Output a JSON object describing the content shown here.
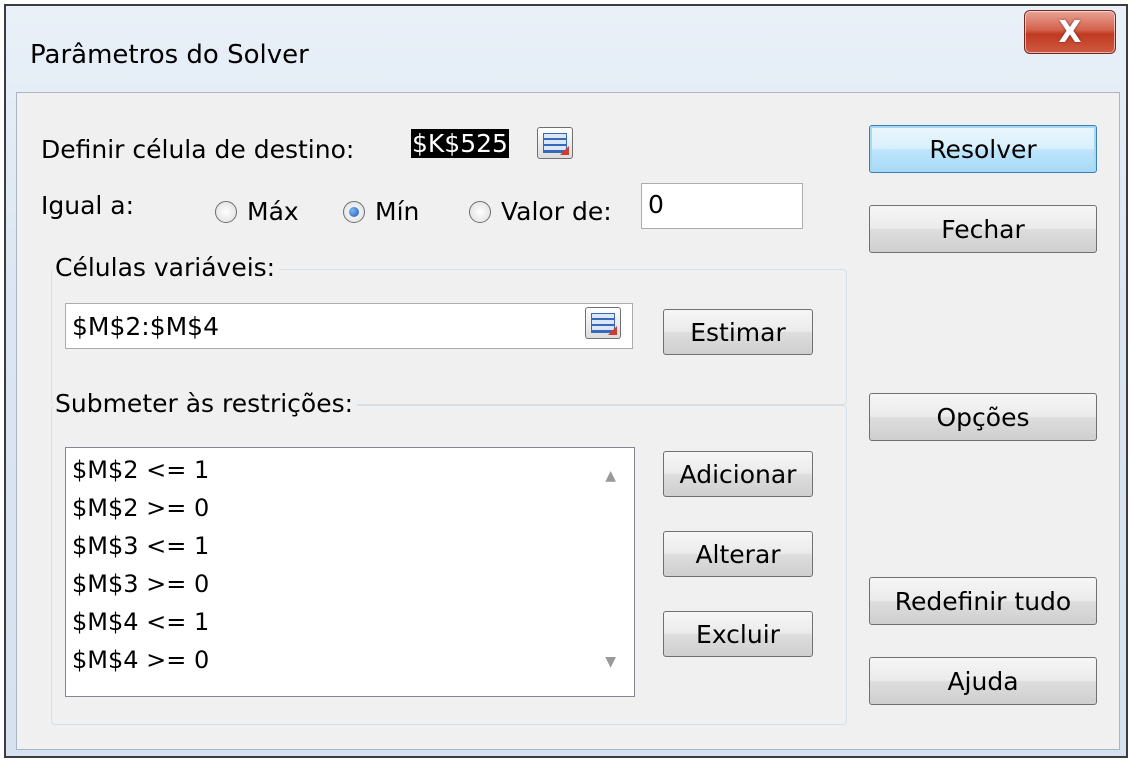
{
  "window": {
    "title": "Parâmetros do Solver",
    "close_label": "X"
  },
  "target": {
    "label": "Definir célula de destino:",
    "value": "$K$525"
  },
  "equal_to": {
    "label": "Igual a:",
    "options": [
      {
        "label": "Máx",
        "checked": false
      },
      {
        "label": "Mín",
        "checked": true
      },
      {
        "label": "Valor de:",
        "checked": false
      }
    ],
    "value": "0"
  },
  "variable_cells": {
    "legend": "Células variáveis:",
    "value": "$M$2:$M$4",
    "estimate_button": "Estimar"
  },
  "constraints": {
    "legend": "Submeter às restrições:",
    "items": [
      "$M$2 <= 1",
      "$M$2 >= 0",
      "$M$3 <= 1",
      "$M$3 >= 0",
      "$M$4 <= 1",
      "$M$4 >= 0"
    ],
    "add_button": "Adicionar",
    "change_button": "Alterar",
    "delete_button": "Excluir"
  },
  "side_buttons": {
    "solve": "Resolver",
    "close": "Fechar",
    "options": "Opções",
    "reset_all": "Redefinir tudo",
    "help": "Ajuda"
  },
  "icons": {
    "refedit": "range-selector-icon",
    "scroll_up": "scroll-up-arrow-icon",
    "scroll_down": "scroll-down-arrow-icon"
  }
}
